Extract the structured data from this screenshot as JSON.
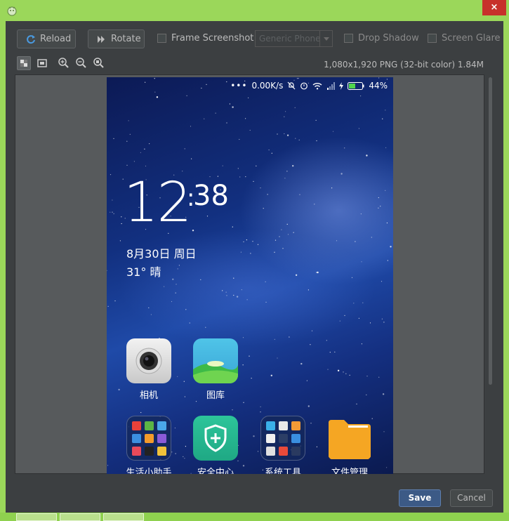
{
  "window": {
    "close_label": "×"
  },
  "toolbar": {
    "reload_label": "Reload",
    "rotate_label": "Rotate",
    "frame_screenshot_label": "Frame Screenshot",
    "device_combo_value": "Generic Phone",
    "drop_shadow_label": "Drop Shadow",
    "screen_glare_label": "Screen Glare"
  },
  "view_tools": {
    "items": [
      "checkerboard-icon",
      "frame-icon",
      "zoom-in-icon",
      "zoom-out-icon",
      "zoom-actual-icon"
    ],
    "image_info": "1,080x1,920 PNG (32-bit color) 1.84M"
  },
  "phone": {
    "status": {
      "net_speed": "0.00K/s",
      "battery": "44%"
    },
    "clock": {
      "hour": "12",
      "minute": "38"
    },
    "date": "8月30日 周日",
    "weather": "31°  晴",
    "apps": [
      {
        "label": "相机"
      },
      {
        "label": "图库"
      },
      {
        "label": "生活小助手"
      },
      {
        "label": "安全中心"
      },
      {
        "label": "系统工具"
      },
      {
        "label": "文件管理"
      }
    ]
  },
  "dialog": {
    "save_label": "Save",
    "cancel_label": "Cancel"
  },
  "colors": {
    "accent": "#3c5a86",
    "window_frame": "#9bd75a",
    "close": "#c7312b",
    "panel": "#3c3f41"
  }
}
